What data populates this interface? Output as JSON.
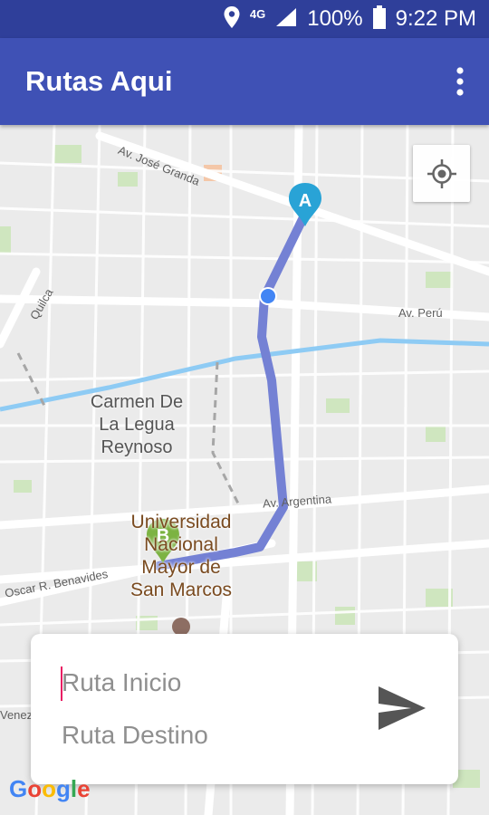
{
  "status_bar": {
    "network": "4G",
    "battery": "100%",
    "time": "9:22 PM"
  },
  "app_bar": {
    "title": "Rutas Aqui"
  },
  "map": {
    "street_labels": [
      "Av. José Granda",
      "Av. Perú",
      "Av. Argentina",
      "Oscar R. Benavides",
      "Quilca",
      "Venez"
    ],
    "places": {
      "carmen": "Carmen De\nLa Legua\nReynoso",
      "universidad": "Universidad\nNacional\nMayor de\nSan Marcos"
    },
    "markers": {
      "start": "A",
      "end": "B"
    },
    "route_color": "#7481d4",
    "attribution": "Google"
  },
  "route_form": {
    "start_placeholder": "Ruta Inicio",
    "end_placeholder": "Ruta Destino"
  },
  "colors": {
    "primary": "#3f51b5",
    "primary_dark": "#2f3f9a",
    "marker_a": "#29a3d6",
    "marker_b": "#7cb342",
    "caret": "#e91e63"
  }
}
